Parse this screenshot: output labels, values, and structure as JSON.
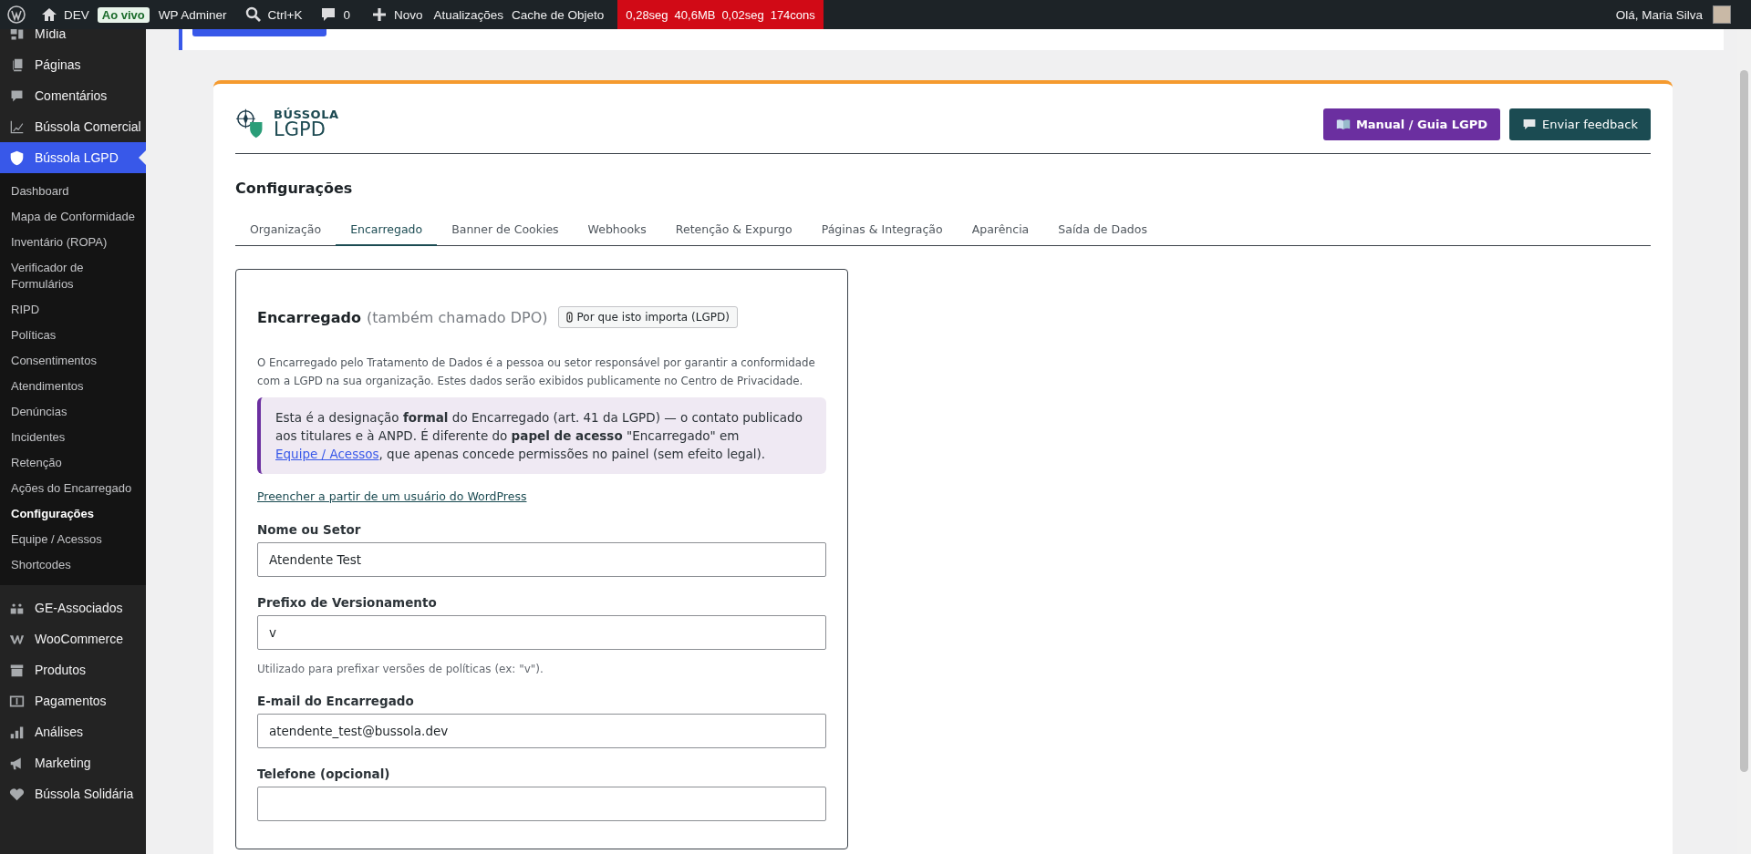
{
  "admin_bar": {
    "site": "DEV",
    "live_badge": "Ao vivo",
    "links": [
      "WP Adminer",
      "Ctrl+K",
      "0",
      "Novo",
      "Atualizações",
      "Cache de Objeto"
    ],
    "perf": [
      "0,28seg",
      "40,6MB",
      "0,02seg",
      "174cons"
    ],
    "greeting": "Olá, Maria Silva"
  },
  "sidebar": {
    "items": [
      {
        "label": "Mídia",
        "selected": false
      },
      {
        "label": "Páginas",
        "selected": false
      },
      {
        "label": "Comentários",
        "selected": false
      },
      {
        "label": "Bússola Comercial",
        "selected": false
      },
      {
        "label": "Bússola LGPD",
        "selected": true,
        "children": [
          {
            "label": "Dashboard",
            "selected": false
          },
          {
            "label": "Mapa de Conformidade",
            "selected": false
          },
          {
            "label": "Inventário (ROPA)",
            "selected": false
          },
          {
            "label": "Verificador de Formulários",
            "selected": false
          },
          {
            "label": "RIPD",
            "selected": false
          },
          {
            "label": "Políticas",
            "selected": false
          },
          {
            "label": "Consentimentos",
            "selected": false
          },
          {
            "label": "Atendimentos",
            "selected": false
          },
          {
            "label": "Denúncias",
            "selected": false
          },
          {
            "label": "Incidentes",
            "selected": false
          },
          {
            "label": "Retenção",
            "selected": false
          },
          {
            "label": "Ações do Encarregado",
            "selected": false
          },
          {
            "label": "Configurações",
            "selected": true
          },
          {
            "label": "Equipe / Acessos",
            "selected": false
          },
          {
            "label": "Shortcodes",
            "selected": false
          }
        ]
      },
      {
        "label": "GE-Associados",
        "selected": false
      },
      {
        "label": "WooCommerce",
        "selected": false
      },
      {
        "label": "Produtos",
        "selected": false
      },
      {
        "label": "Pagamentos",
        "selected": false
      },
      {
        "label": "Análises",
        "selected": false
      },
      {
        "label": "Marketing",
        "selected": false
      },
      {
        "label": "Bússola Solidária",
        "selected": false
      }
    ]
  },
  "header": {
    "logo_top": "BÚSSOLA",
    "logo_bottom": "LGPD",
    "buttons": [
      {
        "label": "Manual / Guia LGPD",
        "kind": "manual"
      },
      {
        "label": "Enviar feedback",
        "kind": "feedback"
      }
    ]
  },
  "page_title": "Configurações",
  "tabs": [
    {
      "label": "Organização",
      "selected": false
    },
    {
      "label": "Encarregado",
      "selected": true
    },
    {
      "label": "Banner de Cookies",
      "selected": false
    },
    {
      "label": "Webhooks",
      "selected": false
    },
    {
      "label": "Retenção & Expurgo",
      "selected": false
    },
    {
      "label": "Páginas & Integração",
      "selected": false
    },
    {
      "label": "Aparência",
      "selected": false
    },
    {
      "label": "Saída de Dados",
      "selected": false
    }
  ],
  "panel": {
    "title": "Encarregado",
    "subtitle": "(também chamado DPO)",
    "help_button": "Por que isto importa (LGPD)",
    "description": "O Encarregado pelo Tratamento de Dados é a pessoa ou setor responsável por garantir a conformidade com a LGPD na sua organização. Estes dados serão exibidos publicamente no Centro de Privacidade.",
    "notice": {
      "before": "Esta é a designação **formal** do Encarregado (art. 41 da LGPD) — o contato publicado aos titulares e à ANPD. É diferente do **papel de acesso** \"Encarregado\" em",
      "link": "Equipe / Acessos",
      "after": ", que apenas concede permissões no painel (sem efeito legal)."
    },
    "fill_link": "Preencher a partir de um usuário do WordPress",
    "fields": [
      {
        "label": "Nome ou Setor",
        "value": "Atendente Test"
      },
      {
        "label": "Prefixo de Versionamento",
        "value": "v",
        "hint": "Utilizado para prefixar versões de políticas (ex: \"v\")."
      },
      {
        "label": "E-mail do Encarregado",
        "value": "atendente_test@bussola.dev"
      },
      {
        "label": "Telefone (opcional)"
      }
    ]
  }
}
